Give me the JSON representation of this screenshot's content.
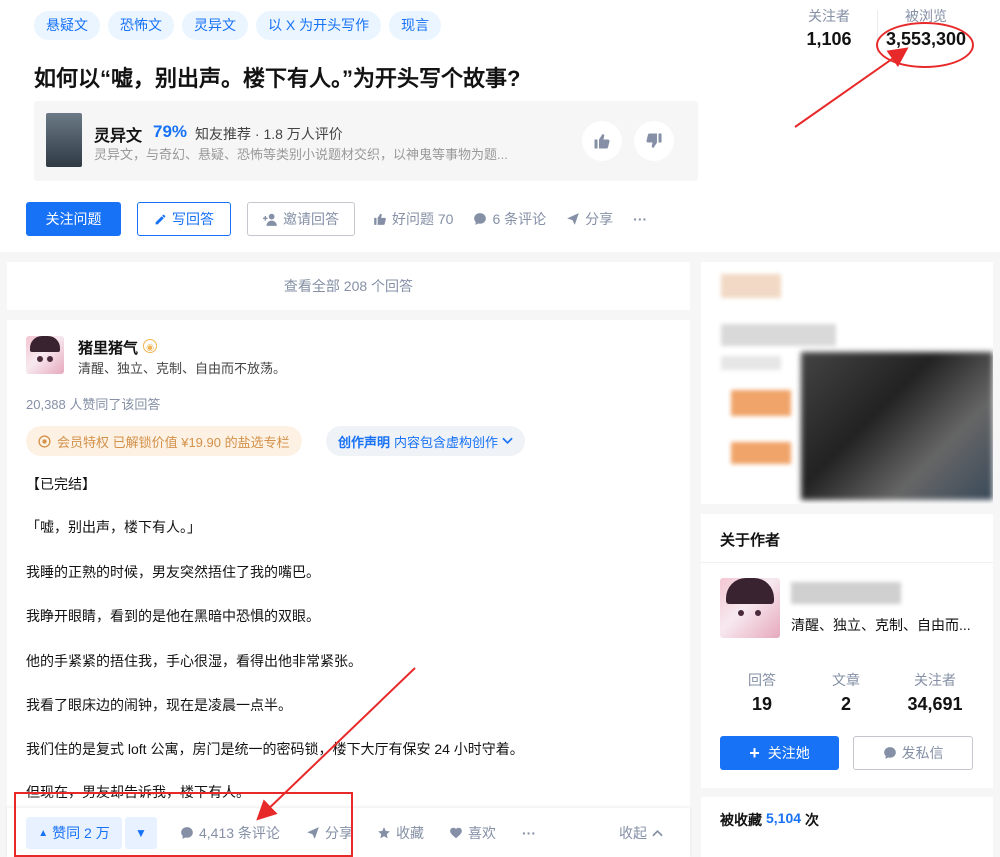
{
  "tags": [
    "悬疑文",
    "恐怖文",
    "灵异文",
    "以 X 为开头写作",
    "现言"
  ],
  "question": {
    "title": "如何以“嘘，别出声。楼下有人。”为开头写个故事?",
    "followers_label": "关注者",
    "followers": "1,106",
    "views_label": "被浏览",
    "views": "3,553,300"
  },
  "topic": {
    "name": "灵异文",
    "percent": "79%",
    "info": "知友推荐 · 1.8 万人评价",
    "desc": "灵异文，与奇幻、悬疑、恐怖等类别小说题材交织，以神鬼等事物为题..."
  },
  "actions": {
    "follow": "关注问题",
    "write": "写回答",
    "invite": "邀请回答",
    "good": "好问题 70",
    "comments": "6 条评论",
    "share": "分享",
    "more": "···"
  },
  "view_all": "查看全部 208 个回答",
  "answer": {
    "author": "猪里猪气",
    "bio": "清醒、独立、克制、自由而不放荡。",
    "vote_summary": "20,388 人赞同了该回答",
    "vip": "会员特权 已解锁价值 ¥19.90 的盐选专栏",
    "decl_label": "创作声明",
    "decl_text": "内容包含虚构创作",
    "paragraphs": [
      "【已完结】",
      "「嘘，别出声，楼下有人。」",
      "我睡的正熟的时候，男友突然捂住了我的嘴巴。",
      "我睁开眼睛，看到的是他在黑暗中恐惧的双眼。",
      "他的手紧紧的捂住我，手心很湿，看得出他非常紧张。",
      "我看了眼床边的闹钟，现在是凌晨一点半。",
      "我们住的是复式 loft 公寓，房门是统一的密码锁，楼下大厅有保安 24 小时守着。",
      "但现在，男友却告诉我，楼下有人。"
    ]
  },
  "bottombar": {
    "upvote": "赞同 2 万",
    "comments": "4,413 条评论",
    "share": "分享",
    "collect": "收藏",
    "like": "喜欢",
    "more": "···",
    "fold": "收起"
  },
  "author_card": {
    "title": "关于作者",
    "bio": "清醒、独立、克制、自由而...",
    "answers_label": "回答",
    "answers": "19",
    "articles_label": "文章",
    "articles": "2",
    "followers_label": "关注者",
    "followers": "34,691",
    "follow_btn": "关注她",
    "message_btn": "发私信"
  },
  "collected": {
    "label": "被收藏",
    "count": "5,104",
    "unit": "次"
  },
  "colors": {
    "brand": "#1772f6",
    "annotation_red": "#e8292a"
  }
}
